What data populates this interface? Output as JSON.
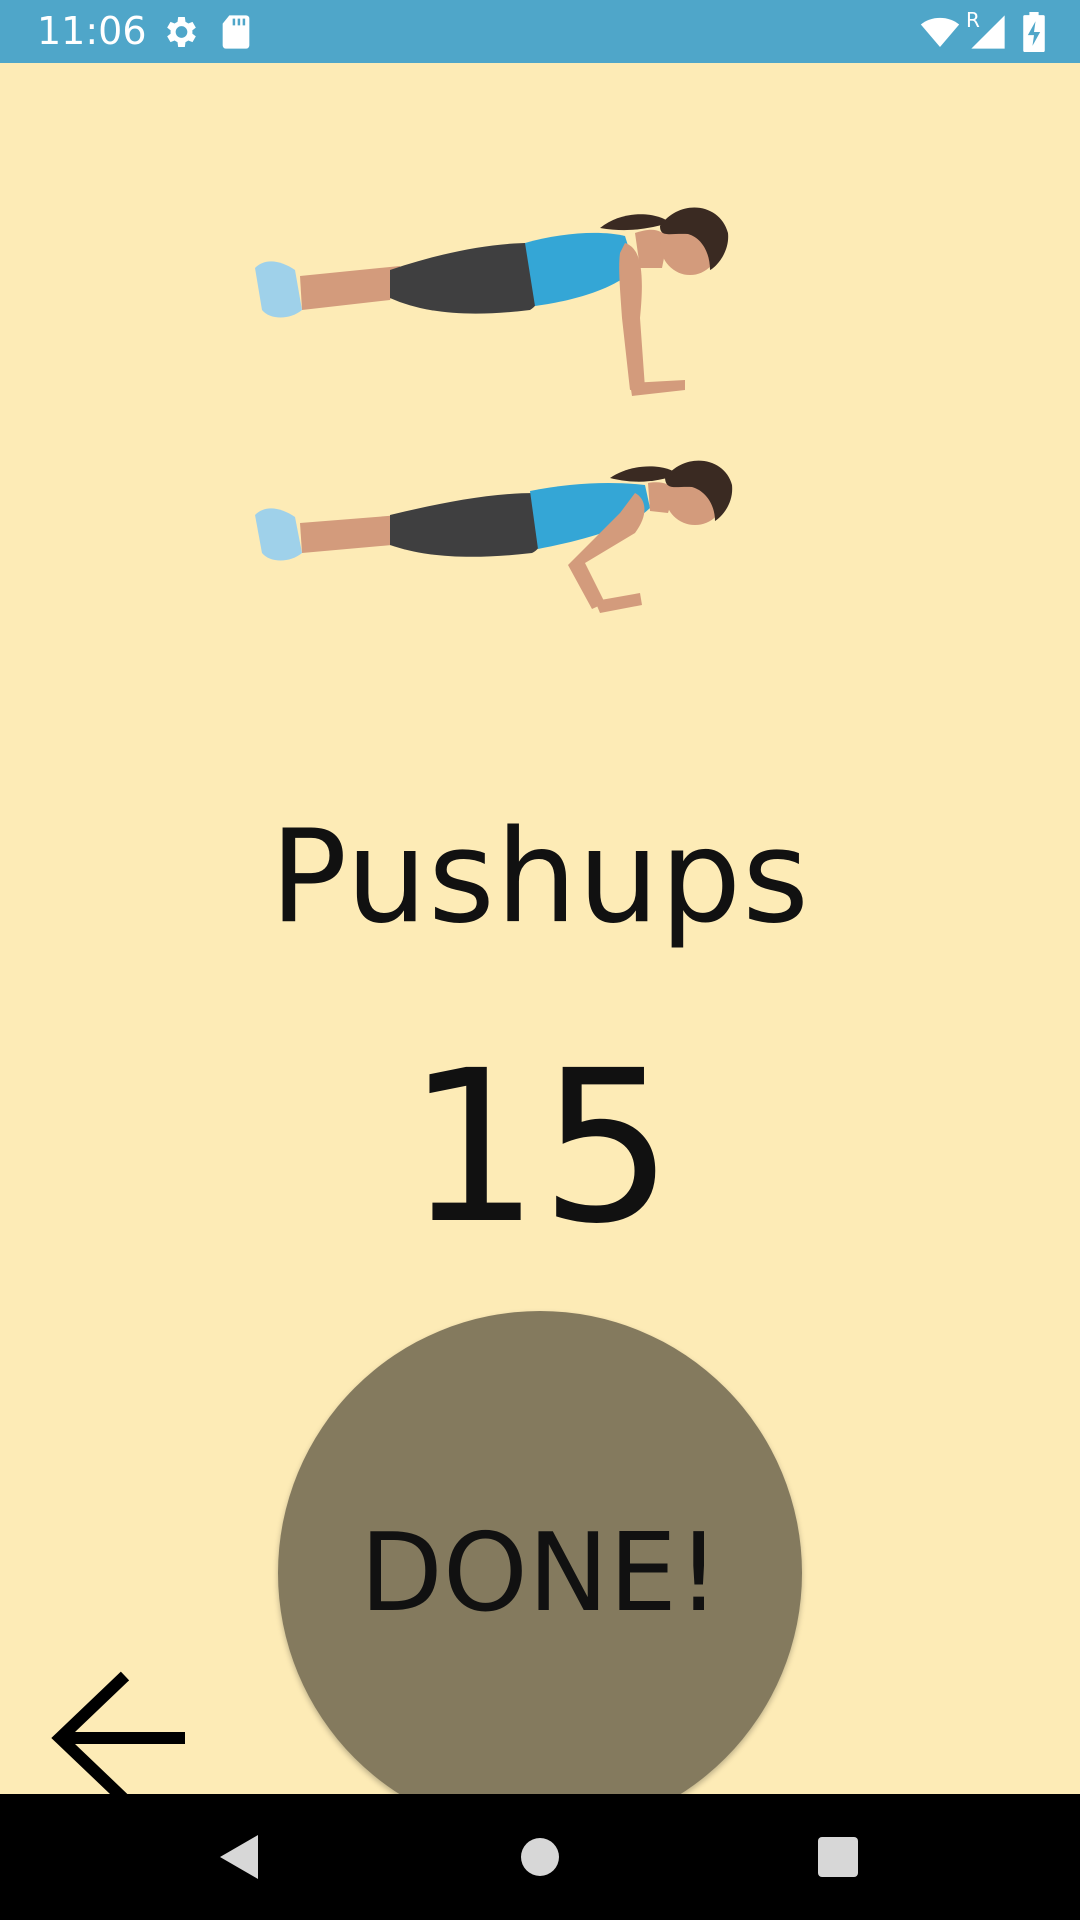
{
  "status_bar": {
    "time": "11:06",
    "left_icons": [
      "gear-icon",
      "sd-card-icon"
    ],
    "right_icons": [
      "wifi-icon",
      "signal-icon",
      "battery-charging-icon"
    ],
    "roaming_indicator": "R",
    "color": "#4fa6c9"
  },
  "exercise": {
    "name": "Pushups",
    "reps": "15",
    "illustration": "pushup-illustration"
  },
  "done_button": {
    "label": "DONE!",
    "color": "#847a5e"
  },
  "back_button": {
    "icon": "arrow-left-icon"
  },
  "nav_bar": {
    "buttons": [
      "back-triangle-icon",
      "home-circle-icon",
      "recents-square-icon"
    ]
  },
  "theme": {
    "background": "#fdebb6"
  }
}
